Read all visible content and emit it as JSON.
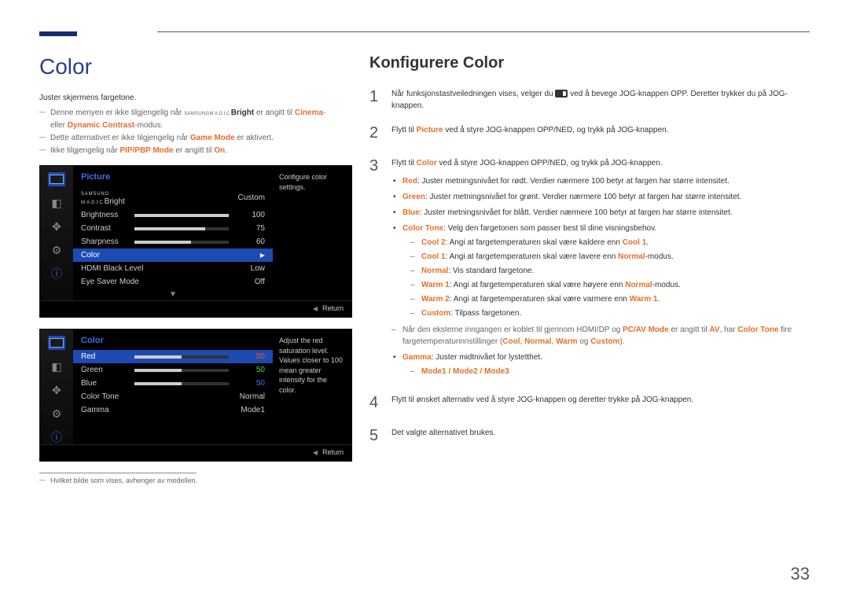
{
  "page_number": "33",
  "left": {
    "title": "Color",
    "intro": "Juster skjermens fargetone.",
    "notes": [
      {
        "pre": "Denne menyen er ikke tilgjengelig når ",
        "brand_pre": "SAMSUNG",
        "brand_main": "MAGIC",
        "brand_suf": "Bright",
        "mid": " er angitt til ",
        "strong1": "Cinema",
        "mid2": "- eller ",
        "strong2": "Dynamic Contrast",
        "post": "-modus."
      },
      {
        "pre": "Dette alternativet er ikke tilgjengelig når ",
        "strong": "Game Mode",
        "post": " er aktivert."
      },
      {
        "pre": "Ikke tilgjengelig når ",
        "strong": "PIP/PBP Mode",
        "mid": " er angitt til ",
        "strong2": "On",
        "post": "."
      }
    ],
    "osd1": {
      "header": "Picture",
      "desc": "Configure color settings.",
      "magic_label_pre": "SAMSUNG",
      "magic_label_mid": "MAGIC",
      "magic_label_suf": "Bright",
      "rows": [
        {
          "label": "Brightness",
          "value": "100",
          "fill": "100%"
        },
        {
          "label": "Contrast",
          "value": "75",
          "fill": "75%"
        },
        {
          "label": "Sharpness",
          "value": "60",
          "fill": "60%"
        }
      ],
      "row_magic_value": "Custom",
      "row_color": "Color",
      "row_hdmi": {
        "label": "HDMI Black Level",
        "value": "Low"
      },
      "row_eye": {
        "label": "Eye Saver Mode",
        "value": "Off"
      },
      "return": "Return"
    },
    "osd2": {
      "header": "Color",
      "desc": "Adjust the red saturation level. Values closer to 100 mean greater intensity for the color.",
      "rows": [
        {
          "label": "Red",
          "value": "50",
          "selected": true
        },
        {
          "label": "Green",
          "value": "50"
        },
        {
          "label": "Blue",
          "value": "50"
        },
        {
          "label": "Color Tone",
          "value": "Normal"
        },
        {
          "label": "Gamma",
          "value": "Mode1"
        }
      ],
      "return": "Return"
    },
    "footnote": "Hvilket bilde som vises, avhenger av modellen."
  },
  "right": {
    "title": "Konfigurere Color",
    "step1": {
      "pre": "Når funksjonstastveiledningen vises, velger du ",
      "post": " ved å bevege JOG-knappen OPP. Deretter trykker du på JOG-knappen."
    },
    "step2": {
      "pre": "Flytt til ",
      "strong": "Picture",
      "post": " ved å styre JOG-knappen OPP/NED, og trykk på JOG-knappen."
    },
    "step3": {
      "pre": "Flytt til ",
      "strong": "Color",
      "post": " ved å styre JOG-knappen OPP/NED, og trykk på JOG-knappen.",
      "bullets": [
        {
          "strong": "Red",
          "text": ": Juster metningsnivået for rødt. Verdier nærmere 100 betyr at fargen har større intensitet."
        },
        {
          "strong": "Green",
          "text": ": Juster metningsnivået for grønt. Verdier nærmere 100 betyr at fargen har større intensitet."
        },
        {
          "strong": "Blue",
          "text": ": Juster metningsnivået for blått. Verdier nærmere 100 betyr at fargen har større intensitet."
        }
      ],
      "colortone": {
        "strong": "Color Tone",
        "text": ": Velg den fargetonen som passer best til dine visningsbehov.",
        "subs": [
          {
            "s1": "Cool 2",
            "mid": ": Angi at fargetemperaturen skal være kaldere enn ",
            "s2": "Cool 1",
            "post": "."
          },
          {
            "s1": "Cool 1",
            "mid": ": Angi at fargetemperaturen skal være lavere enn ",
            "s2": "Normal",
            "post": "-modus."
          },
          {
            "s1": "Normal",
            "mid": ": Vis standard fargetone.",
            "s2": "",
            "post": ""
          },
          {
            "s1": "Warm 1",
            "mid": ": Angi at fargetemperaturen skal være høyere enn ",
            "s2": "Normal",
            "post": "-modus."
          },
          {
            "s1": "Warm 2",
            "mid": ": Angi at fargetemperaturen skal være varmere enn ",
            "s2": "Warm 1",
            "post": "."
          },
          {
            "s1": "Custom",
            "mid": ": Tilpass fargetonen.",
            "s2": "",
            "post": ""
          }
        ],
        "note": {
          "pre": "Når den eksterne inngangen er koblet til gjennom HDMI/DP og ",
          "s1": "PC/AV Mode",
          "mid1": " er angitt til ",
          "s2": "AV",
          "mid2": ", har ",
          "s3": "Color Tone",
          "post": " fire fargetemperaturinnstillinger (",
          "t1": "Cool",
          "t2": "Normal",
          "t3": "Warm",
          "t4": "Custom",
          "end": ")."
        }
      },
      "gamma": {
        "strong": "Gamma",
        "text": ": Juster midtnivået for lystetthet.",
        "modes": "Mode1 / Mode2 / Mode3"
      }
    },
    "step4": "Flytt til ønsket alternativ ved å styre JOG-knappen og deretter trykke på JOG-knappen.",
    "step5": "Det valgte alternativet brukes."
  }
}
